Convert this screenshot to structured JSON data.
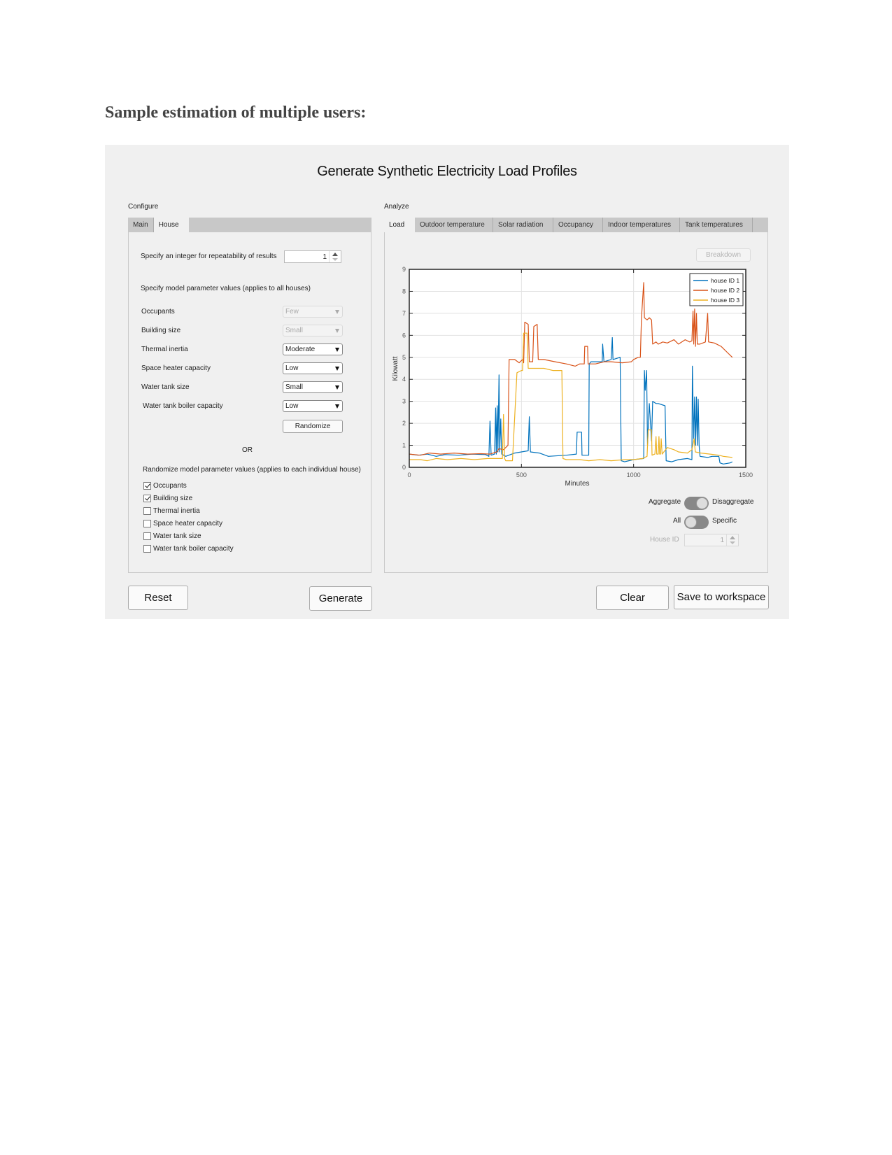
{
  "document": {
    "heading": "Sample estimation of multiple users:"
  },
  "app": {
    "title": "Generate Synthetic Electricity Load Profiles",
    "configure": {
      "label": "Configure",
      "tabs": [
        {
          "label": "Main",
          "active": false
        },
        {
          "label": "House",
          "active": true
        }
      ],
      "seed_label": "Specify an integer for repeatability of results",
      "seed_value": "1",
      "params_heading": "Specify model parameter values  (applies to all houses)",
      "params": [
        {
          "label": "Occupants",
          "value": "Few",
          "enabled": false
        },
        {
          "label": "Building size",
          "value": "Small",
          "enabled": false
        },
        {
          "label": "Thermal inertia",
          "value": "Moderate",
          "enabled": true
        },
        {
          "label": "Space heater capacity",
          "value": "Low",
          "enabled": true
        },
        {
          "label": "Water tank size",
          "value": "Small",
          "enabled": true
        },
        {
          "label": "Water tank boiler capacity",
          "value": "Low",
          "enabled": true
        }
      ],
      "randomize_label": "Randomize",
      "or_label": "OR",
      "randomize_heading": "Randomize model parameter values (applies to each individual house)",
      "randomize_checks": [
        {
          "label": "Occupants",
          "checked": true
        },
        {
          "label": "Building size",
          "checked": true
        },
        {
          "label": "Thermal inertia",
          "checked": false
        },
        {
          "label": "Space heater capacity",
          "checked": false
        },
        {
          "label": "Water tank size",
          "checked": false
        },
        {
          "label": "Water tank boiler capacity",
          "checked": false
        }
      ]
    },
    "analyze": {
      "label": "Analyze",
      "tabs": [
        {
          "label": "Load",
          "active": true
        },
        {
          "label": "Outdoor temperature",
          "active": false
        },
        {
          "label": "Solar radiation",
          "active": false
        },
        {
          "label": "Occupancy",
          "active": false
        },
        {
          "label": "Indoor temperatures",
          "active": false
        },
        {
          "label": "Tank temperatures",
          "active": false
        }
      ],
      "breakdown_label": "Breakdown",
      "switch1": {
        "left": "Aggregate",
        "right": "Disaggregate",
        "state": "Disaggregate"
      },
      "switch2": {
        "left": "All",
        "right": "Specific",
        "state": "All"
      },
      "house_id_label": "House ID",
      "house_id_value": "1"
    },
    "buttons": {
      "reset": "Reset",
      "generate": "Generate",
      "clear": "Clear",
      "save": "Save to workspace"
    }
  },
  "chart_data": {
    "type": "line",
    "title": "",
    "xlabel": "Minutes",
    "ylabel": "Kilowatt",
    "xlim": [
      0,
      1500
    ],
    "ylim": [
      0,
      9
    ],
    "xticks": [
      0,
      500,
      1000,
      1500
    ],
    "yticks": [
      0,
      1,
      2,
      3,
      4,
      5,
      6,
      7,
      8,
      9
    ],
    "grid": true,
    "legend": "top-right",
    "series": [
      {
        "name": "house ID 1",
        "color": "#0072BD",
        "points": [
          [
            0,
            0.6
          ],
          [
            40,
            0.55
          ],
          [
            80,
            0.6
          ],
          [
            120,
            0.5
          ],
          [
            160,
            0.58
          ],
          [
            220,
            0.55
          ],
          [
            280,
            0.6
          ],
          [
            340,
            0.58
          ],
          [
            355,
            0.5
          ],
          [
            360,
            2.1
          ],
          [
            365,
            0.55
          ],
          [
            380,
            0.6
          ],
          [
            385,
            2.7
          ],
          [
            388,
            0.6
          ],
          [
            392,
            2.8
          ],
          [
            395,
            0.7
          ],
          [
            400,
            4.2
          ],
          [
            403,
            0.7
          ],
          [
            408,
            2.2
          ],
          [
            412,
            0.6
          ],
          [
            430,
            0.5
          ],
          [
            470,
            0.65
          ],
          [
            500,
            0.7
          ],
          [
            530,
            0.75
          ],
          [
            535,
            2.3
          ],
          [
            540,
            0.7
          ],
          [
            580,
            0.65
          ],
          [
            620,
            0.5
          ],
          [
            700,
            0.55
          ],
          [
            745,
            0.6
          ],
          [
            748,
            1.6
          ],
          [
            768,
            1.6
          ],
          [
            770,
            0.55
          ],
          [
            800,
            0.55
          ],
          [
            802,
            4.7
          ],
          [
            810,
            4.8
          ],
          [
            860,
            4.8
          ],
          [
            862,
            5.6
          ],
          [
            868,
            4.8
          ],
          [
            900,
            4.9
          ],
          [
            905,
            5.9
          ],
          [
            908,
            4.9
          ],
          [
            940,
            5.0
          ],
          [
            945,
            0.3
          ],
          [
            960,
            0.25
          ],
          [
            1000,
            0.35
          ],
          [
            1045,
            0.4
          ],
          [
            1048,
            4.4
          ],
          [
            1052,
            3.5
          ],
          [
            1058,
            4.4
          ],
          [
            1062,
            1.0
          ],
          [
            1070,
            2.9
          ],
          [
            1080,
            1.2
          ],
          [
            1085,
            3.0
          ],
          [
            1100,
            2.9
          ],
          [
            1110,
            2.9
          ],
          [
            1140,
            2.8
          ],
          [
            1145,
            0.3
          ],
          [
            1170,
            0.25
          ],
          [
            1200,
            0.35
          ],
          [
            1240,
            0.4
          ],
          [
            1260,
            0.35
          ],
          [
            1262,
            4.6
          ],
          [
            1265,
            2.9
          ],
          [
            1268,
            1.3
          ],
          [
            1272,
            3.2
          ],
          [
            1276,
            1.0
          ],
          [
            1280,
            3.2
          ],
          [
            1284,
            1.0
          ],
          [
            1288,
            3.1
          ],
          [
            1292,
            1.0
          ],
          [
            1296,
            0.5
          ],
          [
            1330,
            0.45
          ],
          [
            1350,
            0.5
          ],
          [
            1380,
            0.5
          ],
          [
            1385,
            0.2
          ],
          [
            1400,
            0.15
          ],
          [
            1430,
            0.2
          ],
          [
            1440,
            0.25
          ]
        ]
      },
      {
        "name": "house ID 2",
        "color": "#D95319",
        "points": [
          [
            0,
            0.6
          ],
          [
            50,
            0.55
          ],
          [
            90,
            0.65
          ],
          [
            140,
            0.6
          ],
          [
            200,
            0.65
          ],
          [
            260,
            0.6
          ],
          [
            320,
            0.62
          ],
          [
            360,
            0.6
          ],
          [
            390,
            0.7
          ],
          [
            400,
            0.85
          ],
          [
            420,
            0.8
          ],
          [
            440,
            1.0
          ],
          [
            445,
            4.9
          ],
          [
            470,
            4.9
          ],
          [
            490,
            4.75
          ],
          [
            505,
            4.9
          ],
          [
            510,
            4.75
          ],
          [
            515,
            6.6
          ],
          [
            530,
            6.5
          ],
          [
            535,
            4.8
          ],
          [
            550,
            4.8
          ],
          [
            555,
            6.4
          ],
          [
            570,
            6.5
          ],
          [
            575,
            4.9
          ],
          [
            600,
            4.9
          ],
          [
            650,
            4.8
          ],
          [
            700,
            4.7
          ],
          [
            740,
            4.6
          ],
          [
            760,
            4.7
          ],
          [
            780,
            4.7
          ],
          [
            782,
            5.5
          ],
          [
            795,
            5.5
          ],
          [
            797,
            4.7
          ],
          [
            830,
            4.7
          ],
          [
            870,
            4.8
          ],
          [
            900,
            4.8
          ],
          [
            950,
            4.75
          ],
          [
            990,
            4.8
          ],
          [
            1000,
            4.9
          ],
          [
            1020,
            5.0
          ],
          [
            1030,
            5.0
          ],
          [
            1035,
            6.8
          ],
          [
            1045,
            8.4
          ],
          [
            1048,
            6.8
          ],
          [
            1060,
            6.7
          ],
          [
            1070,
            6.8
          ],
          [
            1080,
            6.7
          ],
          [
            1085,
            5.6
          ],
          [
            1100,
            5.7
          ],
          [
            1110,
            5.6
          ],
          [
            1130,
            5.7
          ],
          [
            1150,
            5.65
          ],
          [
            1180,
            5.8
          ],
          [
            1200,
            5.6
          ],
          [
            1230,
            5.8
          ],
          [
            1250,
            5.7
          ],
          [
            1260,
            5.75
          ],
          [
            1265,
            7.1
          ],
          [
            1268,
            5.6
          ],
          [
            1272,
            7.2
          ],
          [
            1276,
            5.5
          ],
          [
            1280,
            7.0
          ],
          [
            1284,
            5.6
          ],
          [
            1295,
            5.6
          ],
          [
            1320,
            5.7
          ],
          [
            1330,
            7.0
          ],
          [
            1334,
            5.7
          ],
          [
            1360,
            5.65
          ],
          [
            1390,
            5.5
          ],
          [
            1420,
            5.2
          ],
          [
            1440,
            5.0
          ]
        ]
      },
      {
        "name": "house ID 3",
        "color": "#EDB120",
        "points": [
          [
            0,
            0.35
          ],
          [
            50,
            0.35
          ],
          [
            80,
            0.3
          ],
          [
            120,
            0.4
          ],
          [
            170,
            0.35
          ],
          [
            230,
            0.4
          ],
          [
            290,
            0.35
          ],
          [
            350,
            0.4
          ],
          [
            400,
            0.4
          ],
          [
            415,
            0.4
          ],
          [
            420,
            2.4
          ],
          [
            425,
            0.4
          ],
          [
            430,
            0.3
          ],
          [
            460,
            0.3
          ],
          [
            480,
            4.3
          ],
          [
            500,
            4.4
          ],
          [
            505,
            4.4
          ],
          [
            510,
            6.1
          ],
          [
            525,
            6.1
          ],
          [
            530,
            4.5
          ],
          [
            570,
            4.5
          ],
          [
            600,
            4.5
          ],
          [
            640,
            4.4
          ],
          [
            680,
            4.4
          ],
          [
            685,
            0.4
          ],
          [
            700,
            0.35
          ],
          [
            760,
            0.35
          ],
          [
            800,
            0.3
          ],
          [
            850,
            0.35
          ],
          [
            900,
            0.3
          ],
          [
            960,
            0.35
          ],
          [
            1000,
            0.35
          ],
          [
            1040,
            0.4
          ],
          [
            1060,
            0.5
          ],
          [
            1065,
            1.7
          ],
          [
            1080,
            1.7
          ],
          [
            1082,
            0.55
          ],
          [
            1095,
            0.6
          ],
          [
            1100,
            1.4
          ],
          [
            1103,
            0.6
          ],
          [
            1110,
            0.6
          ],
          [
            1113,
            1.4
          ],
          [
            1116,
            0.6
          ],
          [
            1120,
            0.6
          ],
          [
            1123,
            1.3
          ],
          [
            1127,
            0.6
          ],
          [
            1150,
            0.9
          ],
          [
            1180,
            0.8
          ],
          [
            1200,
            0.7
          ],
          [
            1240,
            0.65
          ],
          [
            1260,
            0.8
          ],
          [
            1270,
            1.3
          ],
          [
            1275,
            0.7
          ],
          [
            1300,
            0.65
          ],
          [
            1340,
            0.6
          ],
          [
            1380,
            0.55
          ],
          [
            1400,
            0.5
          ],
          [
            1440,
            0.45
          ]
        ]
      }
    ]
  }
}
